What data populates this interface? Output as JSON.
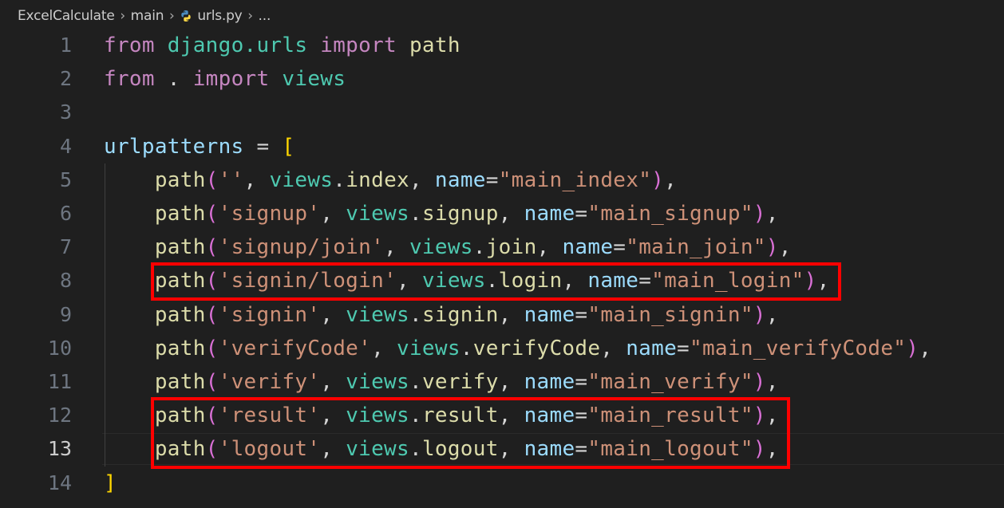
{
  "breadcrumb": {
    "project": "ExcelCalculate",
    "folder": "main",
    "file": "urls.py",
    "more": "..."
  },
  "editor": {
    "language": "python",
    "active_line": 13,
    "highlighted_lines": [
      8,
      12,
      13
    ],
    "highlight_color": "#ff0000",
    "lines": [
      {
        "n": "1",
        "tokens": [
          [
            "kw",
            "from"
          ],
          [
            "op",
            " "
          ],
          [
            "mod",
            "django.urls"
          ],
          [
            "op",
            " "
          ],
          [
            "kw",
            "import"
          ],
          [
            "op",
            " "
          ],
          [
            "fn",
            "path"
          ]
        ]
      },
      {
        "n": "2",
        "tokens": [
          [
            "kw",
            "from"
          ],
          [
            "op",
            " . "
          ],
          [
            "kw",
            "import"
          ],
          [
            "op",
            " "
          ],
          [
            "mod",
            "views"
          ]
        ]
      },
      {
        "n": "3",
        "tokens": []
      },
      {
        "n": "4",
        "tokens": [
          [
            "var",
            "urlpatterns"
          ],
          [
            "op",
            " = "
          ],
          [
            "br1",
            "["
          ]
        ]
      },
      {
        "n": "5",
        "tokens": [
          [
            "op",
            "    "
          ],
          [
            "fn",
            "path"
          ],
          [
            "br2",
            "("
          ],
          [
            "str",
            "''"
          ],
          [
            "op",
            ", "
          ],
          [
            "mod",
            "views"
          ],
          [
            "op",
            "."
          ],
          [
            "fn",
            "index"
          ],
          [
            "op",
            ", "
          ],
          [
            "var",
            "name"
          ],
          [
            "op",
            "="
          ],
          [
            "str",
            "\"main_index\""
          ],
          [
            "br2",
            ")"
          ],
          [
            "op",
            ","
          ]
        ]
      },
      {
        "n": "6",
        "tokens": [
          [
            "op",
            "    "
          ],
          [
            "fn",
            "path"
          ],
          [
            "br2",
            "("
          ],
          [
            "str",
            "'signup'"
          ],
          [
            "op",
            ", "
          ],
          [
            "mod",
            "views"
          ],
          [
            "op",
            "."
          ],
          [
            "fn",
            "signup"
          ],
          [
            "op",
            ", "
          ],
          [
            "var",
            "name"
          ],
          [
            "op",
            "="
          ],
          [
            "str",
            "\"main_signup\""
          ],
          [
            "br2",
            ")"
          ],
          [
            "op",
            ","
          ]
        ]
      },
      {
        "n": "7",
        "tokens": [
          [
            "op",
            "    "
          ],
          [
            "fn",
            "path"
          ],
          [
            "br2",
            "("
          ],
          [
            "str",
            "'signup/join'"
          ],
          [
            "op",
            ", "
          ],
          [
            "mod",
            "views"
          ],
          [
            "op",
            "."
          ],
          [
            "fn",
            "join"
          ],
          [
            "op",
            ", "
          ],
          [
            "var",
            "name"
          ],
          [
            "op",
            "="
          ],
          [
            "str",
            "\"main_join\""
          ],
          [
            "br2",
            ")"
          ],
          [
            "op",
            ","
          ]
        ]
      },
      {
        "n": "8",
        "tokens": [
          [
            "op",
            "    "
          ],
          [
            "fn",
            "path"
          ],
          [
            "br2",
            "("
          ],
          [
            "str",
            "'signin/login'"
          ],
          [
            "op",
            ", "
          ],
          [
            "mod",
            "views"
          ],
          [
            "op",
            "."
          ],
          [
            "fn",
            "login"
          ],
          [
            "op",
            ", "
          ],
          [
            "var",
            "name"
          ],
          [
            "op",
            "="
          ],
          [
            "str",
            "\"main_login\""
          ],
          [
            "br2",
            ")"
          ],
          [
            "op",
            ","
          ]
        ]
      },
      {
        "n": "9",
        "tokens": [
          [
            "op",
            "    "
          ],
          [
            "fn",
            "path"
          ],
          [
            "br2",
            "("
          ],
          [
            "str",
            "'signin'"
          ],
          [
            "op",
            ", "
          ],
          [
            "mod",
            "views"
          ],
          [
            "op",
            "."
          ],
          [
            "fn",
            "signin"
          ],
          [
            "op",
            ", "
          ],
          [
            "var",
            "name"
          ],
          [
            "op",
            "="
          ],
          [
            "str",
            "\"main_signin\""
          ],
          [
            "br2",
            ")"
          ],
          [
            "op",
            ","
          ]
        ]
      },
      {
        "n": "10",
        "tokens": [
          [
            "op",
            "    "
          ],
          [
            "fn",
            "path"
          ],
          [
            "br2",
            "("
          ],
          [
            "str",
            "'verifyCode'"
          ],
          [
            "op",
            ", "
          ],
          [
            "mod",
            "views"
          ],
          [
            "op",
            "."
          ],
          [
            "fn",
            "verifyCode"
          ],
          [
            "op",
            ", "
          ],
          [
            "var",
            "name"
          ],
          [
            "op",
            "="
          ],
          [
            "str",
            "\"main_verifyCode\""
          ],
          [
            "br2",
            ")"
          ],
          [
            "op",
            ","
          ]
        ]
      },
      {
        "n": "11",
        "tokens": [
          [
            "op",
            "    "
          ],
          [
            "fn",
            "path"
          ],
          [
            "br2",
            "("
          ],
          [
            "str",
            "'verify'"
          ],
          [
            "op",
            ", "
          ],
          [
            "mod",
            "views"
          ],
          [
            "op",
            "."
          ],
          [
            "fn",
            "verify"
          ],
          [
            "op",
            ", "
          ],
          [
            "var",
            "name"
          ],
          [
            "op",
            "="
          ],
          [
            "str",
            "\"main_verify\""
          ],
          [
            "br2",
            ")"
          ],
          [
            "op",
            ","
          ]
        ]
      },
      {
        "n": "12",
        "tokens": [
          [
            "op",
            "    "
          ],
          [
            "fn",
            "path"
          ],
          [
            "br2",
            "("
          ],
          [
            "str",
            "'result'"
          ],
          [
            "op",
            ", "
          ],
          [
            "mod",
            "views"
          ],
          [
            "op",
            "."
          ],
          [
            "fn",
            "result"
          ],
          [
            "op",
            ", "
          ],
          [
            "var",
            "name"
          ],
          [
            "op",
            "="
          ],
          [
            "str",
            "\"main_result\""
          ],
          [
            "br2",
            ")"
          ],
          [
            "op",
            ","
          ]
        ]
      },
      {
        "n": "13",
        "tokens": [
          [
            "op",
            "    "
          ],
          [
            "fn",
            "path"
          ],
          [
            "br2",
            "("
          ],
          [
            "str",
            "'logout'"
          ],
          [
            "op",
            ", "
          ],
          [
            "mod",
            "views"
          ],
          [
            "op",
            "."
          ],
          [
            "fn",
            "logout"
          ],
          [
            "op",
            ", "
          ],
          [
            "var",
            "name"
          ],
          [
            "op",
            "="
          ],
          [
            "str",
            "\"main_logout\""
          ],
          [
            "br2",
            ")"
          ],
          [
            "op",
            ","
          ]
        ]
      },
      {
        "n": "14",
        "tokens": [
          [
            "br1",
            "]"
          ]
        ]
      }
    ]
  }
}
